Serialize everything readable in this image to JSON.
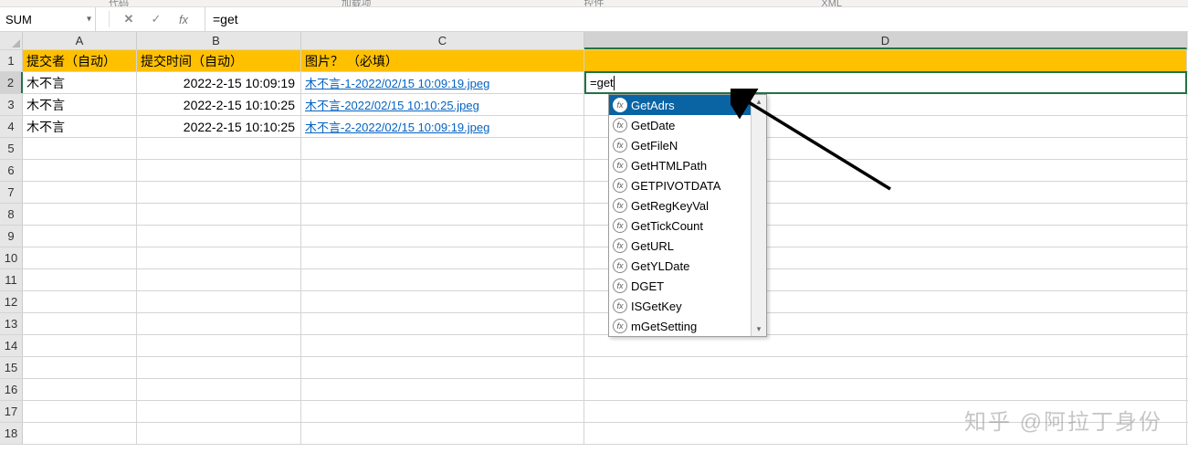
{
  "ribbon_hints": [
    "代码",
    "加载项",
    "控件",
    "XML"
  ],
  "name_box": {
    "value": "SUM"
  },
  "fx_tools": {
    "cancel": "✕",
    "confirm": "✓",
    "fx": "fx"
  },
  "formula_bar": {
    "value": "=get"
  },
  "columns": [
    "A",
    "B",
    "C",
    "D"
  ],
  "row_numbers": [
    "1",
    "2",
    "3",
    "4",
    "5",
    "6",
    "7",
    "8",
    "9",
    "10",
    "11",
    "12",
    "13",
    "14",
    "15",
    "16",
    "17",
    "18"
  ],
  "header_row": {
    "a": "提交者（自动）",
    "b": "提交时间（自动）",
    "c": "图片？ （必填）",
    "d": ""
  },
  "rows": [
    {
      "a": "木不言",
      "b": "2022-2-15 10:09:19",
      "c": "木不言-1-2022/02/15 10:09:19.jpeg"
    },
    {
      "a": "木不言",
      "b": "2022-2-15 10:10:25",
      "c": "木不言-2022/02/15 10:10:25.jpeg"
    },
    {
      "a": "木不言",
      "b": "2022-2-15 10:10:25",
      "c": "木不言-2-2022/02/15 10:09:19.jpeg"
    }
  ],
  "active_cell": {
    "address": "D2",
    "value": "=get"
  },
  "autocomplete": {
    "items": [
      "GetAdrs",
      "GetDate",
      "GetFileN",
      "GetHTMLPath",
      "GETPIVOTDATA",
      "GetRegKeyVal",
      "GetTickCount",
      "GetURL",
      "GetYLDate",
      "DGET",
      "ISGetKey",
      "mGetSetting"
    ],
    "selected_index": 0
  },
  "watermark": "知乎 @阿拉丁身份"
}
